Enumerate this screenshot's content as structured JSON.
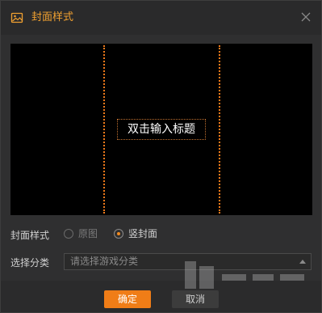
{
  "dialog": {
    "title": "封面样式",
    "icons": {
      "title": "image-icon",
      "close": "close-icon"
    }
  },
  "preview": {
    "title_placeholder": "双击输入标题",
    "guide_color": "#f07a1a"
  },
  "cover_style": {
    "label": "封面样式",
    "options": [
      {
        "label": "原图",
        "selected": false
      },
      {
        "label": "竖封面",
        "selected": true
      }
    ]
  },
  "category": {
    "label": "选择分类",
    "placeholder": "请选择游戏分类"
  },
  "buttons": {
    "confirm": "确定",
    "cancel": "取消"
  },
  "colors": {
    "accent": "#f07d17",
    "title": "#f0a030"
  }
}
